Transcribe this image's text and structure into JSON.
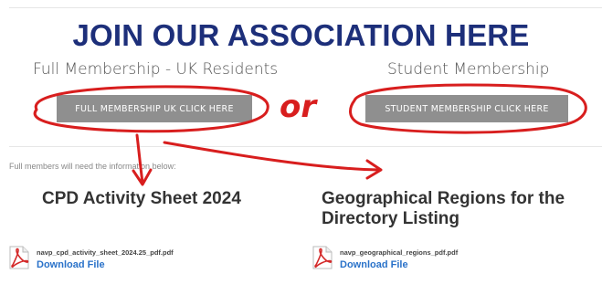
{
  "header": {
    "headline": "JOIN OUR ASSOCIATION HERE",
    "full_label": "Full Membership - UK Residents",
    "student_label": "Student Membership"
  },
  "buttons": {
    "uk": "FULL MEMBERSHIP UK CLICK HERE",
    "student": "STUDENT MEMBERSHIP CLICK HERE"
  },
  "annotation": {
    "or_text": "or",
    "color": "#d81e1e"
  },
  "note": "Full members will need the information below:",
  "sections": [
    {
      "title": "CPD Activity Sheet 2024",
      "file_name": "navp_cpd_activity_sheet_2024.25_pdf.pdf",
      "download_label": "Download File"
    },
    {
      "title": "Geographical Regions for the Directory Listing",
      "file_name": "navp_geographical_regions_pdf.pdf",
      "download_label": "Download File"
    }
  ],
  "colors": {
    "headline": "#1d2f7a",
    "button": "#8f8f8f",
    "link": "#2a72c9",
    "pdf_icon": "#d42a2a"
  },
  "icons": {
    "file": "pdf-file-icon"
  }
}
